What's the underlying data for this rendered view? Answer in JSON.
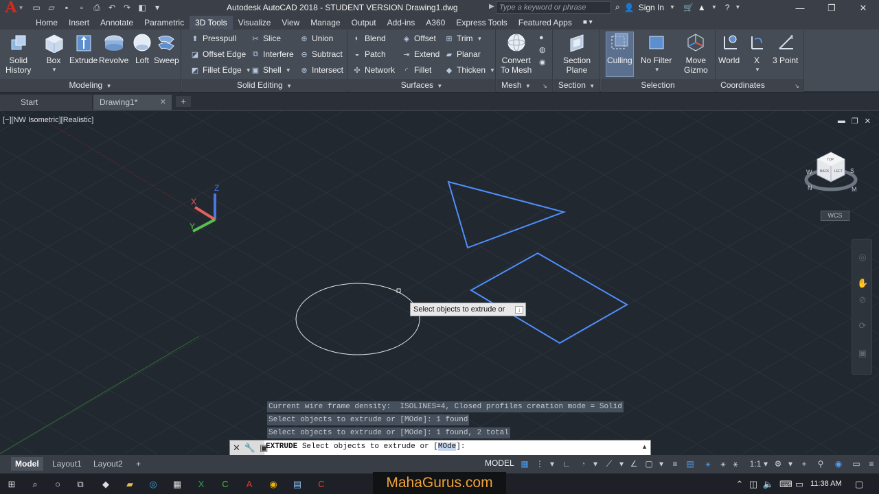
{
  "app": {
    "title": "Autodesk AutoCAD 2018 - STUDENT VERSION    Drawing1.dwg",
    "search_placeholder": "Type a keyword or phrase",
    "sign_in": "Sign In"
  },
  "menu_tabs": [
    "Home",
    "Insert",
    "Annotate",
    "Parametric",
    "3D Tools",
    "Visualize",
    "View",
    "Manage",
    "Output",
    "Add-ins",
    "A360",
    "Express Tools",
    "Featured Apps"
  ],
  "active_tab": "3D Tools",
  "ribbon": {
    "solid_history": {
      "line1": "Solid",
      "line2": "History"
    },
    "modeling": {
      "title": "Modeling",
      "buttons": [
        "Box",
        "Extrude",
        "Revolve",
        "Loft",
        "Sweep"
      ]
    },
    "solid_editing": {
      "title": "Solid Editing",
      "col1": [
        "Presspull",
        "Offset Edge",
        "Fillet Edge"
      ],
      "col2": [
        "Slice",
        "Interfere",
        "Shell"
      ],
      "col3": [
        "Union",
        "Subtract",
        "Intersect"
      ]
    },
    "surfaces": {
      "title": "Surfaces",
      "col1": [
        "Blend",
        "Patch",
        "Network"
      ],
      "col2": [
        "Offset",
        "Extend",
        "Fillet"
      ],
      "col3": [
        "Trim",
        "Planar",
        "Thicken"
      ]
    },
    "mesh": {
      "title": "Mesh",
      "convert1": "Convert",
      "convert2": "To Mesh"
    },
    "section": {
      "title": "Section",
      "plane1": "Section",
      "plane2": "Plane"
    },
    "selection": {
      "title": "Selection",
      "culling": "Culling",
      "nofilter": "No Filter",
      "gizmo1": "Move",
      "gizmo2": "Gizmo"
    },
    "coordinates": {
      "title": "Coordinates",
      "world": "World",
      "x": "X",
      "threepoint": "3 Point"
    }
  },
  "file_tabs": {
    "start": "Start",
    "drawing": "Drawing1*"
  },
  "viewport": {
    "label": "[−][NW Isometric][Realistic]",
    "tooltip": "Select objects to extrude or",
    "wcs": "WCS",
    "viewcube_faces": {
      "top": "TOP",
      "back": "BACK",
      "left": "LEFT"
    },
    "compass": {
      "n": "N",
      "w": "W",
      "s": "S",
      "m": "M"
    },
    "ucs": {
      "x": "X",
      "y": "Y",
      "z": "Z"
    }
  },
  "command": {
    "history": [
      "Current wire frame density:  ISOLINES=4, Closed profiles creation mode = Solid",
      "Select objects to extrude or [MOde]: 1 found",
      "Select objects to extrude or [MOde]: 1 found, 2 total"
    ],
    "keyword": "EXTRUDE",
    "prompt_before": " Select objects to extrude or [",
    "prompt_option": "MOde",
    "prompt_after": "]:"
  },
  "layout_tabs": [
    "Model",
    "Layout1",
    "Layout2"
  ],
  "status": {
    "model": "MODEL",
    "scale": "1:1"
  },
  "taskbar": {
    "time": "11:38 AM"
  },
  "watermark": "MahaGurus.com",
  "colors": {
    "selected_outline": "#4f8fff",
    "viewport_bg": "#212830",
    "ribbon_bg": "#464c55"
  }
}
